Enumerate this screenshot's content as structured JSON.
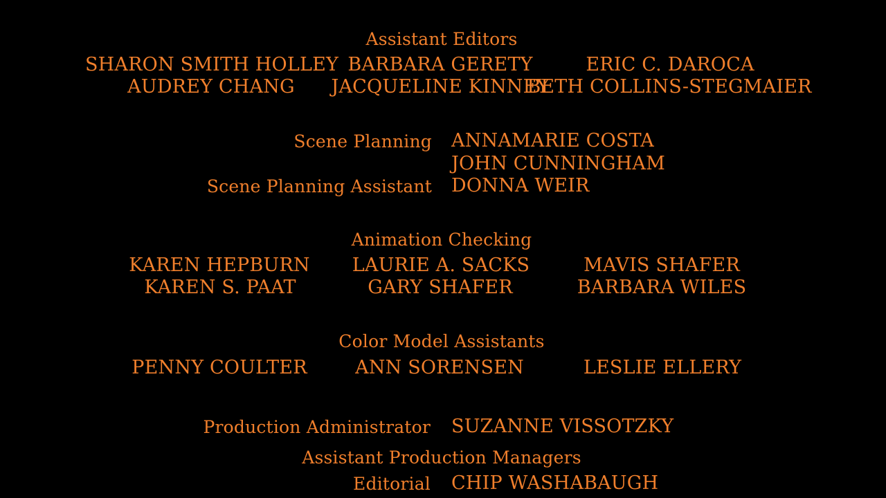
{
  "credits": {
    "assistant_editors": {
      "heading": "Assistant Editors",
      "row1": [
        "SHARON SMITH HOLLEY",
        "BARBARA GERETY",
        "ERIC C. DAROCA"
      ],
      "row2": [
        "AUDREY CHANG",
        "JACQUELINE KINNEY",
        "BETH COLLINS-STEGMAIER"
      ]
    },
    "scene_planning": {
      "label": "Scene Planning",
      "names": [
        "ANNAMARIE COSTA",
        "JOHN CUNNINGHAM"
      ],
      "assistant_label": "Scene Planning Assistant",
      "assistant_name": "DONNA WEIR"
    },
    "animation_checking": {
      "heading": "Animation Checking",
      "row1": [
        "KAREN HEPBURN",
        "LAURIE A. SACKS",
        "MAVIS SHAFER"
      ],
      "row2": [
        "KAREN S. PAAT",
        "GARY SHAFER",
        "BARBARA WILES"
      ]
    },
    "color_model_assistants": {
      "heading": "Color Model Assistants",
      "row1": [
        "PENNY COULTER",
        "ANN SORENSEN",
        "LESLIE ELLERY"
      ]
    },
    "production_administrator": {
      "label": "Production Administrator",
      "name": "SUZANNE VISSOTZKY"
    },
    "assistant_production_managers": {
      "heading": "Assistant Production Managers",
      "partial_label": "Editorial",
      "partial_name": "CHIP WASHABAUGH"
    }
  },
  "colors": {
    "background": "#000000",
    "text": "#f07f2c"
  }
}
